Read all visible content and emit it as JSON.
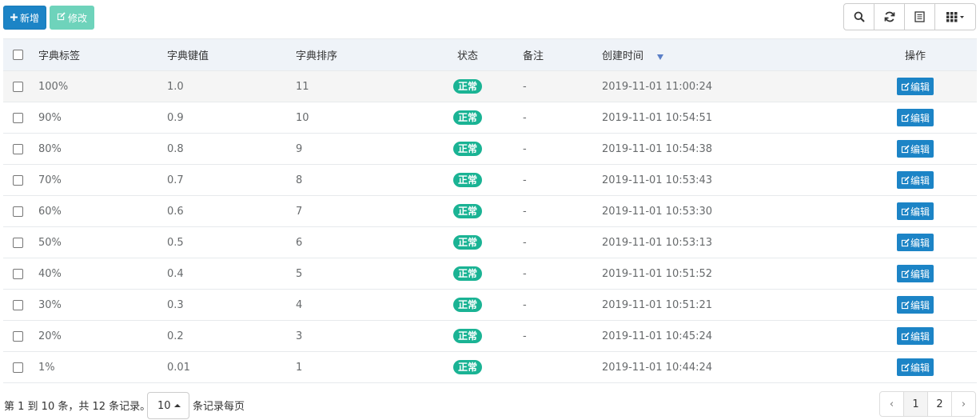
{
  "toolbar": {
    "add_label": "新增",
    "edit_label": "修改",
    "add_icon": "plus-icon",
    "edit_icon": "edit-icon",
    "right_icons": [
      "search-icon",
      "refresh-icon",
      "toggle-view-icon",
      "columns-icon"
    ]
  },
  "table": {
    "headers": {
      "label": "字典标签",
      "value": "字典键值",
      "sort": "字典排序",
      "status": "状态",
      "remark": "备注",
      "created": "创建时间",
      "op": "操作"
    },
    "sorted_column": "created",
    "sort_direction": "desc",
    "rows": [
      {
        "label": "100%",
        "value": "1.0",
        "sort": "11",
        "status": "正常",
        "remark": "-",
        "created": "2019-11-01 11:00:24",
        "action": "编辑"
      },
      {
        "label": "90%",
        "value": "0.9",
        "sort": "10",
        "status": "正常",
        "remark": "-",
        "created": "2019-11-01 10:54:51",
        "action": "编辑"
      },
      {
        "label": "80%",
        "value": "0.8",
        "sort": "9",
        "status": "正常",
        "remark": "-",
        "created": "2019-11-01 10:54:38",
        "action": "编辑"
      },
      {
        "label": "70%",
        "value": "0.7",
        "sort": "8",
        "status": "正常",
        "remark": "-",
        "created": "2019-11-01 10:53:43",
        "action": "编辑"
      },
      {
        "label": "60%",
        "value": "0.6",
        "sort": "7",
        "status": "正常",
        "remark": "-",
        "created": "2019-11-01 10:53:30",
        "action": "编辑"
      },
      {
        "label": "50%",
        "value": "0.5",
        "sort": "6",
        "status": "正常",
        "remark": "-",
        "created": "2019-11-01 10:53:13",
        "action": "编辑"
      },
      {
        "label": "40%",
        "value": "0.4",
        "sort": "5",
        "status": "正常",
        "remark": "-",
        "created": "2019-11-01 10:51:52",
        "action": "编辑"
      },
      {
        "label": "30%",
        "value": "0.3",
        "sort": "4",
        "status": "正常",
        "remark": "-",
        "created": "2019-11-01 10:51:21",
        "action": "编辑"
      },
      {
        "label": "20%",
        "value": "0.2",
        "sort": "3",
        "status": "正常",
        "remark": "-",
        "created": "2019-11-01 10:45:24",
        "action": "编辑"
      },
      {
        "label": "1%",
        "value": "0.01",
        "sort": "1",
        "status": "正常",
        "remark": "",
        "created": "2019-11-01 10:44:24",
        "action": "编辑"
      }
    ]
  },
  "footer": {
    "info": "第 1 到 10 条，共 12 条记录。",
    "page_size": "10",
    "page_size_suffix": "条记录每页",
    "prev": "‹",
    "next": "›",
    "pages": [
      "1",
      "2"
    ],
    "current_page": "1"
  },
  "colors": {
    "primary": "#1c84c6",
    "success": "#1ab394",
    "edit_disabled": "#6ed3bb",
    "header_bg": "#eff3f8"
  }
}
